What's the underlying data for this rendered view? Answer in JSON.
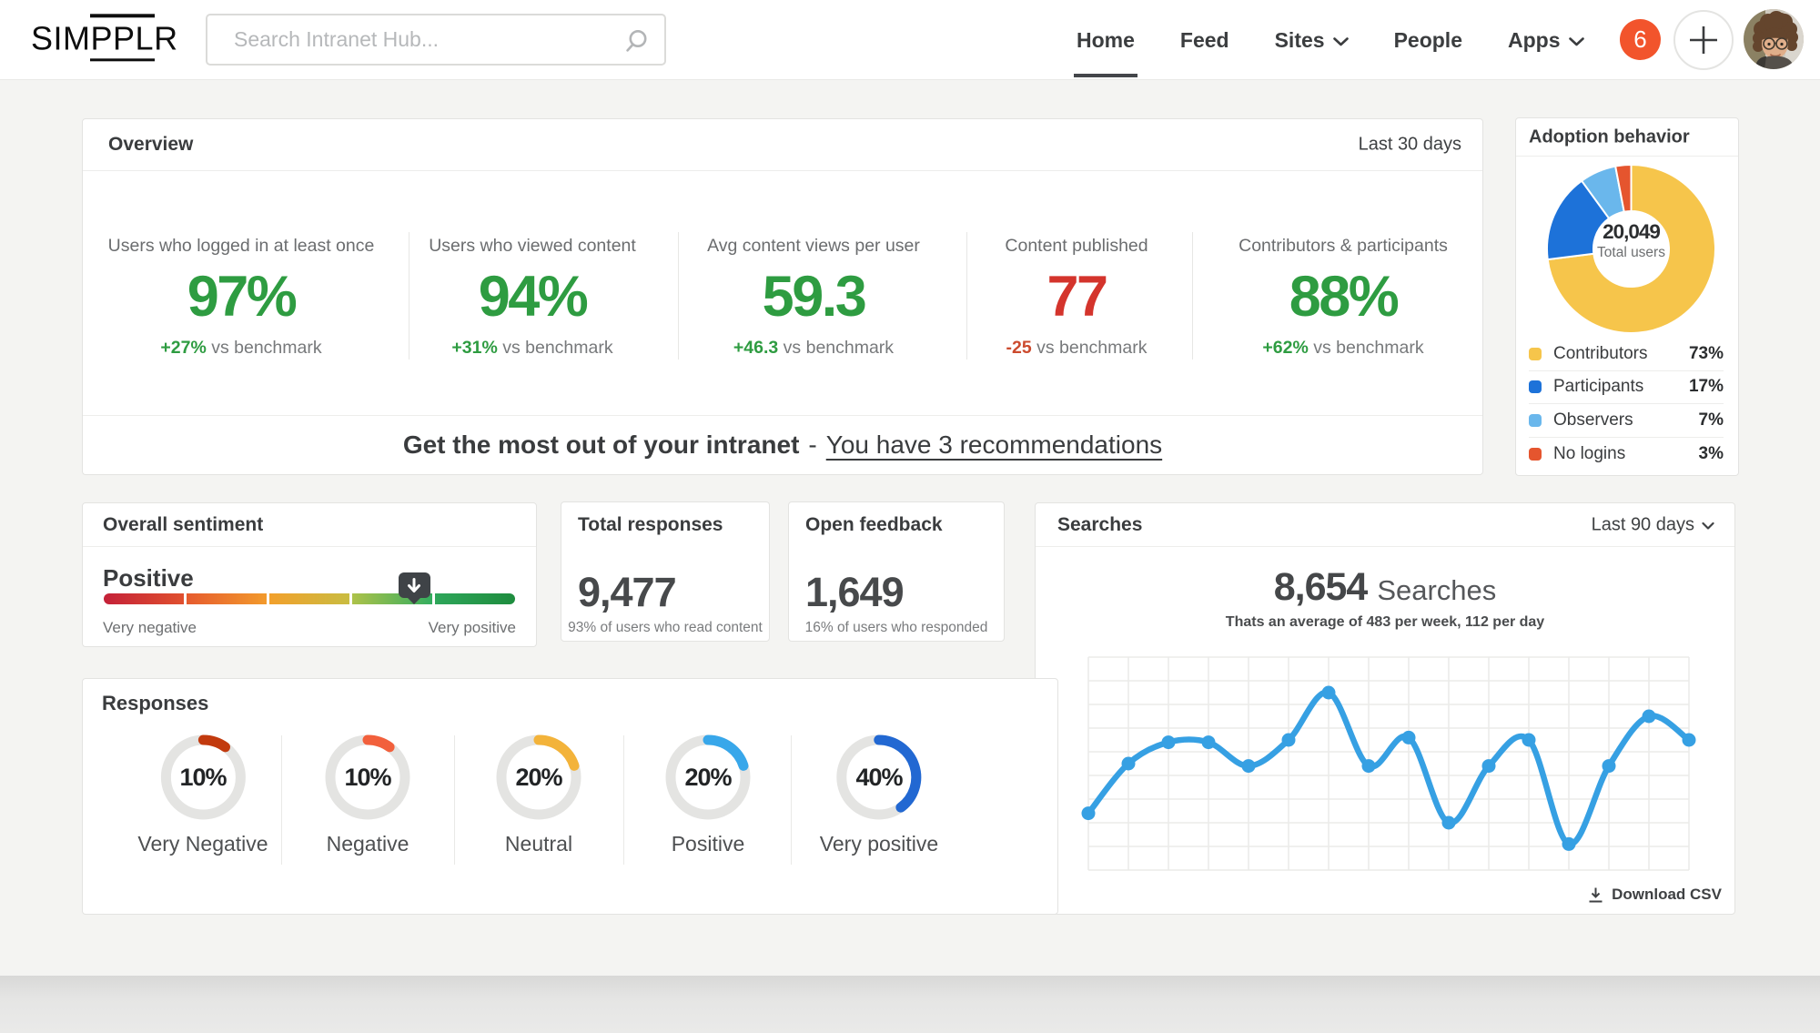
{
  "brand": {
    "logo_pre": "SIM",
    "logo_mid": "PPL",
    "logo_post": "R"
  },
  "search": {
    "placeholder": "Search Intranet Hub..."
  },
  "nav": {
    "items": [
      {
        "label": "Home",
        "active": true,
        "chevron": false
      },
      {
        "label": "Feed",
        "active": false,
        "chevron": false
      },
      {
        "label": "Sites",
        "active": false,
        "chevron": true
      },
      {
        "label": "People",
        "active": false,
        "chevron": false
      },
      {
        "label": "Apps",
        "active": false,
        "chevron": true
      }
    ],
    "notification_count": "6"
  },
  "overview": {
    "title": "Overview",
    "range": "Last 30 days",
    "metrics": [
      {
        "label": "Users who logged in at least once",
        "value": "97%",
        "value_color": "#2e9c41",
        "delta": "+27%",
        "delta_color": "#2e9c41",
        "delta_suffix": "vs benchmark"
      },
      {
        "label": "Users who viewed content",
        "value": "94%",
        "value_color": "#2e9c41",
        "delta": "+31%",
        "delta_color": "#2e9c41",
        "delta_suffix": "vs benchmark"
      },
      {
        "label": "Avg content views per user",
        "value": "59.3",
        "value_color": "#2e9c41",
        "delta": "+46.3",
        "delta_color": "#2e9c41",
        "delta_suffix": "vs benchmark"
      },
      {
        "label": "Content published",
        "value": "77",
        "value_color": "#d4342c",
        "delta": "-25",
        "delta_color": "#cc4b2e",
        "delta_suffix": "vs benchmark"
      },
      {
        "label": "Contributors & participants",
        "value": "88%",
        "value_color": "#2e9c41",
        "delta": "+62%",
        "delta_color": "#2e9c41",
        "delta_suffix": "vs benchmark"
      }
    ],
    "recommendation": {
      "bold": "Get the most out of your intranet",
      "separator": "-",
      "link": "You have 3 recommendations"
    }
  },
  "adoption": {
    "title": "Adoption behavior",
    "center_value": "20,049",
    "center_label": "Total users",
    "legend": [
      {
        "label": "Contributors",
        "value": "73%",
        "color": "#f6c54b"
      },
      {
        "label": "Participants",
        "value": "17%",
        "color": "#1d72d9"
      },
      {
        "label": "Observers",
        "value": "7%",
        "color": "#6ab7ec"
      },
      {
        "label": "No logins",
        "value": "3%",
        "color": "#e5552e"
      }
    ]
  },
  "sentiment": {
    "title": "Overall sentiment",
    "level": "Positive",
    "left_label": "Very negative",
    "right_label": "Very positive",
    "marker_percent": 75.5,
    "segments": [
      [
        "#c42138",
        "#e0502f"
      ],
      [
        "#e65b2f",
        "#f29a2c"
      ],
      [
        "#f2a02c",
        "#c9bc41"
      ],
      [
        "#adc24a",
        "#33ad5f"
      ],
      [
        "#2ea65a",
        "#1e8c3e"
      ]
    ]
  },
  "total_responses": {
    "title": "Total responses",
    "value": "9,477",
    "caption": "93% of users who read content"
  },
  "open_feedback": {
    "title": "Open feedback",
    "value": "1,649",
    "caption": "16% of users who responded"
  },
  "searches": {
    "title": "Searches",
    "range": "Last 90 days",
    "value": "8,654",
    "value_suffix": "Searches",
    "subtitle": "Thats an average of 483 per week, 112 per day",
    "download_label": "Download CSV"
  },
  "responses": {
    "title": "Responses"
  },
  "chart_data": [
    {
      "id": "adoption-donut",
      "type": "pie",
      "title": "Adoption behavior",
      "categories": [
        "Contributors",
        "Participants",
        "Observers",
        "No logins"
      ],
      "values": [
        73,
        17,
        7,
        3
      ],
      "colors": [
        "#f6c54b",
        "#1d72d9",
        "#6ab7ec",
        "#e5552e"
      ],
      "donut": true,
      "center_label": "20,049 Total users",
      "legend_position": "bottom",
      "start_angle_deg": 0,
      "direction": "clockwise"
    },
    {
      "id": "searches-line",
      "type": "line",
      "title": "Searches",
      "x": [
        1,
        2,
        3,
        4,
        5,
        6,
        7,
        8,
        9,
        10,
        11,
        12,
        13,
        14,
        15,
        16
      ],
      "values": [
        2.4,
        4.5,
        5.4,
        5.4,
        4.4,
        5.5,
        7.5,
        4.4,
        5.6,
        2.0,
        4.4,
        5.5,
        1.1,
        4.4,
        6.5,
        5.5
      ],
      "ylim": [
        0,
        9
      ],
      "xlabel": "",
      "ylabel": "",
      "grid": true,
      "grid_cols": 15,
      "grid_rows": 9,
      "color": "#36a0e3",
      "smooth": true,
      "markers": true,
      "note": "no axis tick labels shown; values estimated from gridlines"
    },
    {
      "id": "response-gauges",
      "type": "pie",
      "subtype": "gauge-ring-set",
      "title": "Responses",
      "categories": [
        "Very Negative",
        "Negative",
        "Neutral",
        "Positive",
        "Very positive"
      ],
      "values": [
        10,
        10,
        20,
        20,
        40
      ],
      "display": [
        "10%",
        "10%",
        "20%",
        "20%",
        "40%"
      ],
      "colors": [
        "#c23a0e",
        "#f2603c",
        "#f3b33a",
        "#38a7ea",
        "#2268d2"
      ],
      "track_color": "#e4e4e2"
    }
  ]
}
